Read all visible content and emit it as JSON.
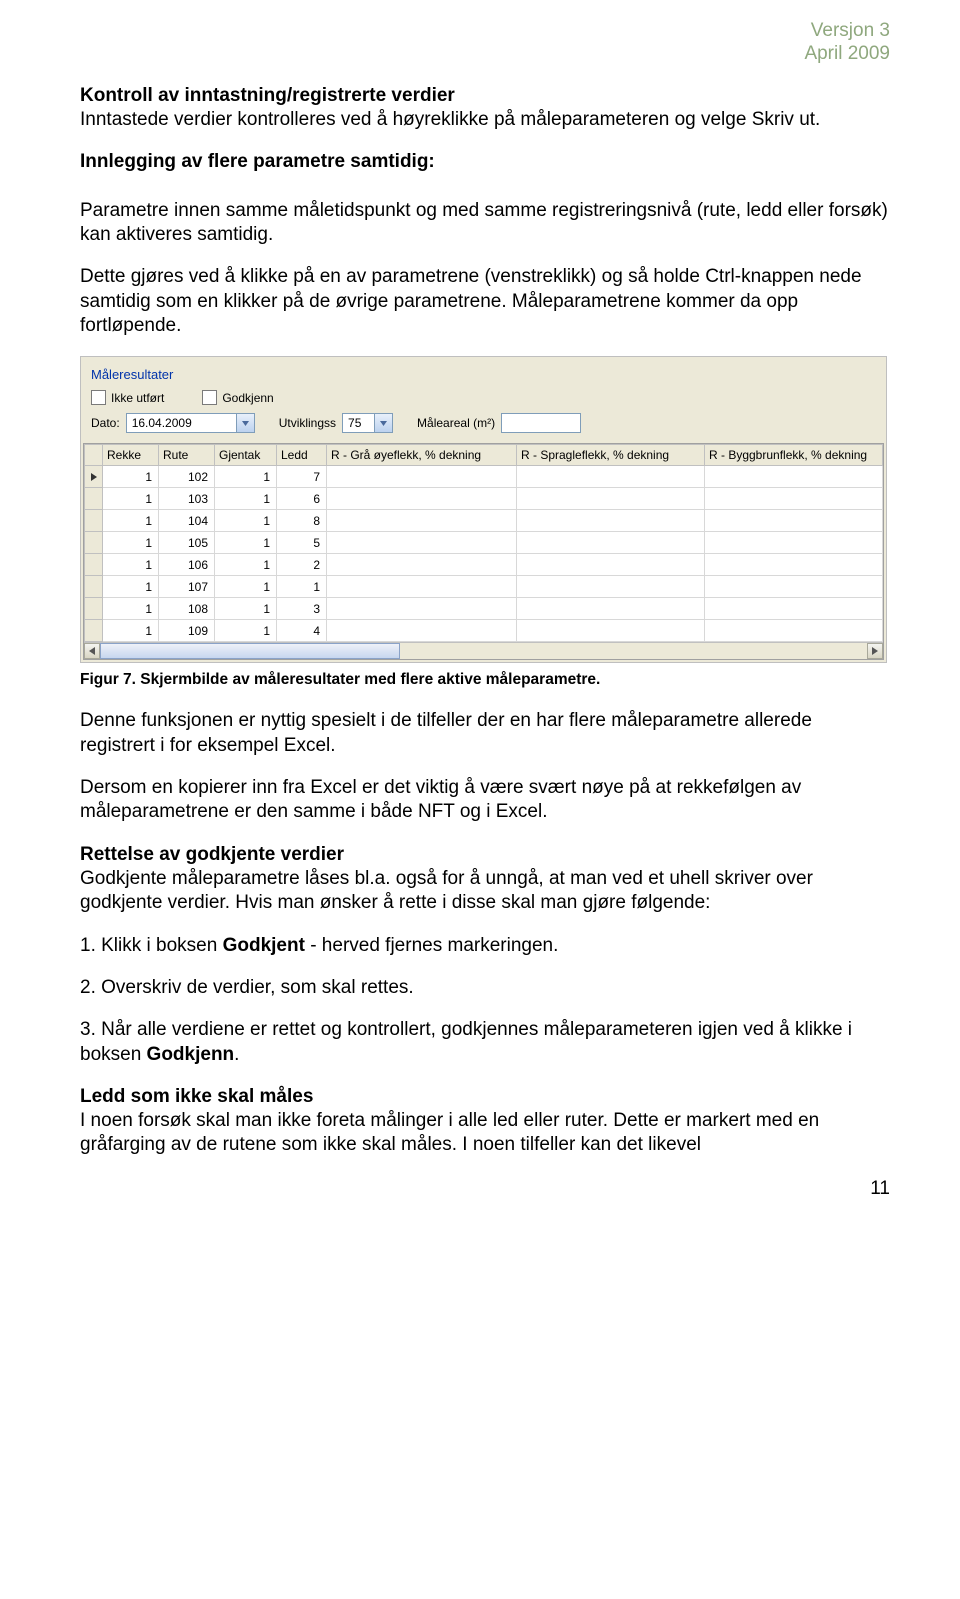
{
  "header": {
    "line1": "Versjon 3",
    "line2": "April 2009"
  },
  "p1_title": "Kontroll av inntastning/registrerte verdier",
  "p1_body": "Inntastede verdier kontrolleres ved å høyreklikke på måleparameteren og velge Skriv ut.",
  "p2_title": "Innlegging av flere parametre samtidig:",
  "p2_body": "Parametre innen samme måletidspunkt og med samme registreringsnivå (rute, ledd eller forsøk) kan aktiveres samtidig.",
  "p3_body": "Dette gjøres ved å klikke på en av parametrene (venstreklikk) og så holde Ctrl-knappen nede samtidig som en klikker på de øvrige parametrene. Måleparametrene kommer da opp fortløpende.",
  "shot": {
    "title": "Måleresultater",
    "chk1": "Ikke utført",
    "chk2": "Godkjenn",
    "lbl_dato": "Dato:",
    "val_dato": "16.04.2009",
    "lbl_utv": "Utviklingss",
    "val_utv": "75",
    "lbl_areal": "Måleareal (m²)",
    "columns": [
      "Rekke",
      "Rute",
      "Gjentak",
      "Ledd",
      "R - Grå øyeflekk, % dekning",
      "R - Spragleflekk, % dekning",
      "R - Byggbrunflekk, % dekning"
    ],
    "rows": [
      {
        "marker": true,
        "c": [
          "1",
          "102",
          "1",
          "7",
          "",
          "",
          ""
        ]
      },
      {
        "marker": false,
        "c": [
          "1",
          "103",
          "1",
          "6",
          "",
          "",
          ""
        ]
      },
      {
        "marker": false,
        "c": [
          "1",
          "104",
          "1",
          "8",
          "",
          "",
          ""
        ]
      },
      {
        "marker": false,
        "c": [
          "1",
          "105",
          "1",
          "5",
          "",
          "",
          ""
        ]
      },
      {
        "marker": false,
        "c": [
          "1",
          "106",
          "1",
          "2",
          "",
          "",
          ""
        ]
      },
      {
        "marker": false,
        "c": [
          "1",
          "107",
          "1",
          "1",
          "",
          "",
          ""
        ]
      },
      {
        "marker": false,
        "c": [
          "1",
          "108",
          "1",
          "3",
          "",
          "",
          ""
        ]
      },
      {
        "marker": false,
        "c": [
          "1",
          "109",
          "1",
          "4",
          "",
          "",
          ""
        ]
      }
    ]
  },
  "figcap": "Figur 7. Skjermbilde av måleresultater med flere aktive måleparametre.",
  "p4": "Denne funksjonen er nyttig spesielt i de tilfeller der en har flere måleparametre allerede registrert i for eksempel Excel.",
  "p5": "Dersom en kopierer inn fra Excel er det viktig å være svært nøye på at rekkefølgen av måleparametrene er den samme i både NFT og i Excel.",
  "p6_title": "Rettelse av godkjente verdier",
  "p6_body": "Godkjente måleparametre låses bl.a. også for å unngå, at man ved et uhell skriver over godkjente verdier. Hvis man ønsker å rette i disse skal man gjøre følgende:",
  "step1_pre": "1. Klikk i boksen ",
  "step1_bold": "Godkjent",
  "step1_post": " - herved fjernes markeringen.",
  "step2": "2. Overskriv de verdier, som skal rettes.",
  "step3_pre": "3. Når alle verdiene er rettet og kontrollert, godkjennes måleparameteren igjen ved å klikke i boksen ",
  "step3_bold": "Godkjenn",
  "step3_post": ".",
  "p7_title": "Ledd som ikke skal måles",
  "p7_body": "I noen forsøk skal man ikke foreta målinger i alle led eller ruter. Dette er markert med en gråfarging av de rutene som ikke skal måles. I noen tilfeller kan det likevel",
  "pagenum": "11"
}
